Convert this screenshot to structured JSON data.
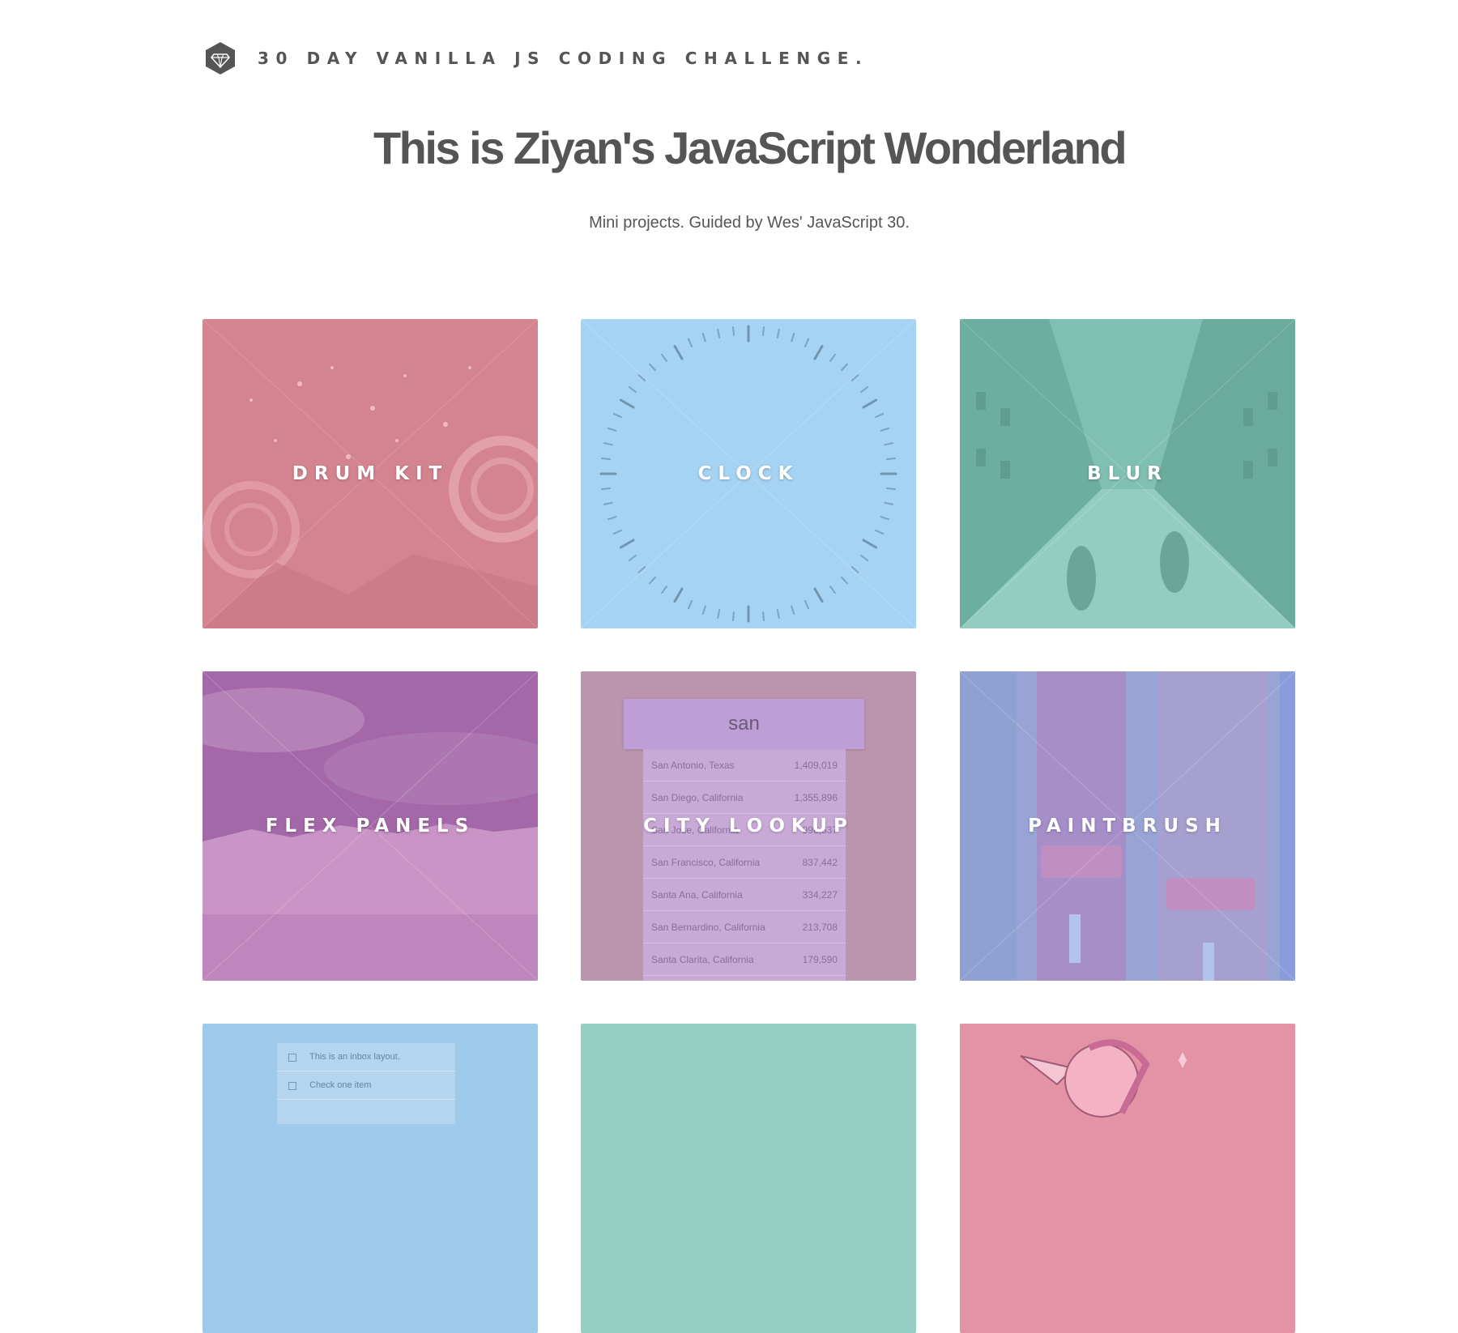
{
  "header": {
    "brand": "30 DAY VANILLA JS CODING CHALLENGE.",
    "logo_icon": "diamond-hexagon-icon"
  },
  "title": "This is Ziyan's JavaScript Wonderland",
  "subtitle": "Mini projects. Guided by Wes' JavaScript 30.",
  "cards": [
    {
      "label": "DRUM KIT",
      "color": "#d88a9a"
    },
    {
      "label": "CLOCK",
      "color": "#a5d3f3"
    },
    {
      "label": "BLUR",
      "color": "#7fbfb0"
    },
    {
      "label": "FLEX PANELS",
      "color": "#b67bb4"
    },
    {
      "label": "CITY LOOKUP",
      "color": "#bb95ad"
    },
    {
      "label": "PAINTBRUSH",
      "color": "#98a4d6"
    },
    {
      "label": "",
      "color": "#9ecbec"
    },
    {
      "label": "",
      "color": "#95cfc4"
    },
    {
      "label": "",
      "color": "#e493a6"
    }
  ],
  "city_lookup": {
    "search_value": "san",
    "results": [
      {
        "name": "San Antonio, Texas",
        "population": "1,409,019"
      },
      {
        "name": "San Diego, California",
        "population": "1,355,896"
      },
      {
        "name": "San Jose, California",
        "population": "998,537"
      },
      {
        "name": "San Francisco, California",
        "population": "837,442"
      },
      {
        "name": "Santa Ana, California",
        "population": "334,227"
      },
      {
        "name": "San Bernardino, California",
        "population": "213,708"
      },
      {
        "name": "Santa Clarita, California",
        "population": "179,590"
      }
    ]
  },
  "inbox": {
    "rows": [
      "This is an inbox layout.",
      "Check one item"
    ]
  }
}
